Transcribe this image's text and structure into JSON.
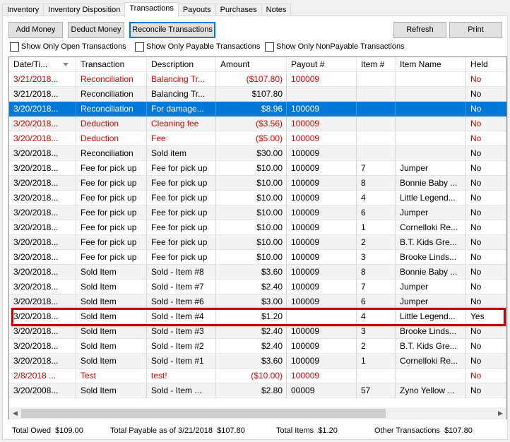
{
  "tabs": [
    "Inventory",
    "Inventory Disposition",
    "Transactions",
    "Payouts",
    "Purchases",
    "Notes"
  ],
  "active_tab": 2,
  "toolbar": {
    "add_money": "Add Money",
    "deduct_money": "Deduct Money",
    "reconcile": "Reconcile Transactions",
    "refresh": "Refresh",
    "print": "Print"
  },
  "filters": {
    "open": "Show Only Open Transactions",
    "payable": "Show Only Payable Transactions",
    "nonpayable": "Show Only NonPayable Transactions"
  },
  "columns": [
    "Date/Ti...",
    "Transaction",
    "Description",
    "Amount",
    "Payout #",
    "Item #",
    "Item Name",
    "Held"
  ],
  "rows": [
    {
      "date": "3/21/2018...",
      "transaction": "Reconciliation",
      "description": "Balancing Tr...",
      "amount": "($107.80)",
      "payout": "100009",
      "item": "",
      "item_name": "",
      "held": "No",
      "style": "red"
    },
    {
      "date": "3/21/2018...",
      "transaction": "Reconciliation",
      "description": "Balancing Tr...",
      "amount": "$107.80",
      "payout": "",
      "item": "",
      "item_name": "",
      "held": "No",
      "style": "normal"
    },
    {
      "date": "3/20/2018...",
      "transaction": "Reconciliation",
      "description": "For damage...",
      "amount": "$8.96",
      "payout": "100009",
      "item": "",
      "item_name": "",
      "held": "No",
      "style": "selected"
    },
    {
      "date": "3/20/2018...",
      "transaction": "Deduction",
      "description": "Cleaning fee",
      "amount": "($3.56)",
      "payout": "100009",
      "item": "",
      "item_name": "",
      "held": "No",
      "style": "red"
    },
    {
      "date": "3/20/2018...",
      "transaction": "Deduction",
      "description": "Fee",
      "amount": "($5.00)",
      "payout": "100009",
      "item": "",
      "item_name": "",
      "held": "No",
      "style": "red"
    },
    {
      "date": "3/20/2018...",
      "transaction": "Reconciliation",
      "description": "Sold item",
      "amount": "$30.00",
      "payout": "100009",
      "item": "",
      "item_name": "",
      "held": "No",
      "style": "normal"
    },
    {
      "date": "3/20/2018...",
      "transaction": "Fee for pick up",
      "description": "Fee for pick up",
      "amount": "$10.00",
      "payout": "100009",
      "item": "7",
      "item_name": "Jumper",
      "held": "No",
      "style": "normal"
    },
    {
      "date": "3/20/2018...",
      "transaction": "Fee for pick up",
      "description": "Fee for pick up",
      "amount": "$10.00",
      "payout": "100009",
      "item": "8",
      "item_name": "Bonnie Baby ...",
      "held": "No",
      "style": "normal"
    },
    {
      "date": "3/20/2018...",
      "transaction": "Fee for pick up",
      "description": "Fee for pick up",
      "amount": "$10.00",
      "payout": "100009",
      "item": "4",
      "item_name": "Little Legend...",
      "held": "No",
      "style": "normal"
    },
    {
      "date": "3/20/2018...",
      "transaction": "Fee for pick up",
      "description": "Fee for pick up",
      "amount": "$10.00",
      "payout": "100009",
      "item": "6",
      "item_name": "Jumper",
      "held": "No",
      "style": "normal"
    },
    {
      "date": "3/20/2018...",
      "transaction": "Fee for pick up",
      "description": "Fee for pick up",
      "amount": "$10.00",
      "payout": "100009",
      "item": "1",
      "item_name": "Cornelloki Re...",
      "held": "No",
      "style": "normal"
    },
    {
      "date": "3/20/2018...",
      "transaction": "Fee for pick up",
      "description": "Fee for pick up",
      "amount": "$10.00",
      "payout": "100009",
      "item": "2",
      "item_name": "B.T. Kids Gre...",
      "held": "No",
      "style": "normal"
    },
    {
      "date": "3/20/2018...",
      "transaction": "Fee for pick up",
      "description": "Fee for pick up",
      "amount": "$10.00",
      "payout": "100009",
      "item": "3",
      "item_name": "Brooke Linds...",
      "held": "No",
      "style": "normal"
    },
    {
      "date": "3/20/2018...",
      "transaction": "Sold Item",
      "description": "Sold - Item #8",
      "amount": "$3.60",
      "payout": "100009",
      "item": "8",
      "item_name": "Bonnie Baby ...",
      "held": "No",
      "style": "normal"
    },
    {
      "date": "3/20/2018...",
      "transaction": "Sold Item",
      "description": "Sold - Item #7",
      "amount": "$2.40",
      "payout": "100009",
      "item": "7",
      "item_name": "Jumper",
      "held": "No",
      "style": "normal"
    },
    {
      "date": "3/20/2018...",
      "transaction": "Sold Item",
      "description": "Sold - Item #6",
      "amount": "$3.00",
      "payout": "100009",
      "item": "6",
      "item_name": "Jumper",
      "held": "No",
      "style": "normal"
    },
    {
      "date": "3/20/2018...",
      "transaction": "Sold Item",
      "description": "Sold - Item #4",
      "amount": "$1.20",
      "payout": "",
      "item": "4",
      "item_name": "Little Legend...",
      "held": "Yes",
      "style": "normal"
    },
    {
      "date": "3/20/2018...",
      "transaction": "Sold Item",
      "description": "Sold - Item #3",
      "amount": "$2.40",
      "payout": "100009",
      "item": "3",
      "item_name": "Brooke Linds...",
      "held": "No",
      "style": "normal"
    },
    {
      "date": "3/20/2018...",
      "transaction": "Sold Item",
      "description": "Sold - Item #2",
      "amount": "$2.40",
      "payout": "100009",
      "item": "2",
      "item_name": "B.T. Kids Gre...",
      "held": "No",
      "style": "normal"
    },
    {
      "date": "3/20/2018...",
      "transaction": "Sold Item",
      "description": "Sold - Item #1",
      "amount": "$3.60",
      "payout": "100009",
      "item": "1",
      "item_name": "Cornelloki Re...",
      "held": "No",
      "style": "normal"
    },
    {
      "date": "2/8/2018 ...",
      "transaction": "Test",
      "description": "test!",
      "amount": "($10.00)",
      "payout": "100009",
      "item": "",
      "item_name": "",
      "held": "No",
      "style": "red"
    },
    {
      "date": "3/20/2008...",
      "transaction": "Sold Item",
      "description": "Sold - Item ...",
      "amount": "$2.80",
      "payout": "00009",
      "item": "57",
      "item_name": "Zyno Yellow ...",
      "held": "No",
      "style": "normal"
    }
  ],
  "footer": {
    "total_owed_label": "Total Owed",
    "total_owed": "$109.00",
    "total_payable_label": "Total Payable as of 3/21/2018",
    "total_payable": "$107.80",
    "total_items_label": "Total Items",
    "total_items": "$1.20",
    "other_label": "Other Transactions",
    "other": "$107.80"
  },
  "colors": {
    "accent": "#0078d7",
    "negative": "#e00000",
    "highlight": "#c00000"
  }
}
